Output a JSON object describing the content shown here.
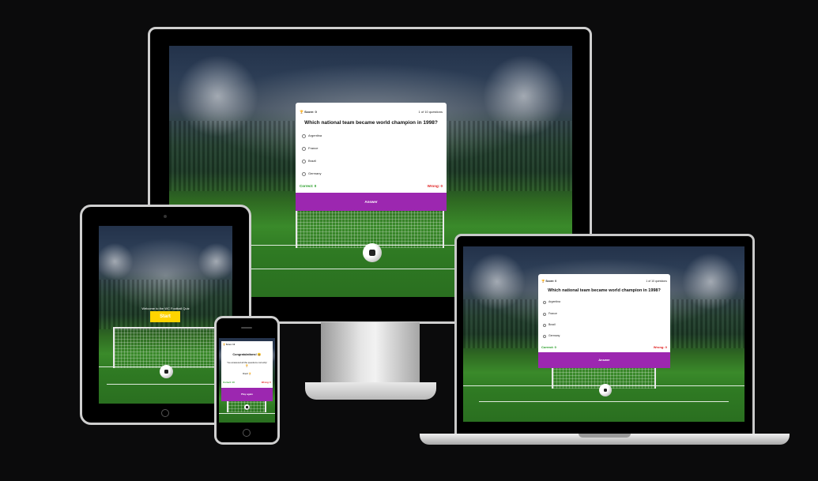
{
  "quiz": {
    "score_label": "Score: 0",
    "progress": "1 of 10 questions",
    "question": "Which national team became world champion in 1998?",
    "options": [
      "Argentina",
      "France",
      "Brazil",
      "Germany"
    ],
    "correct": "Correct: 0",
    "wrong": "Wrong: 0",
    "answer_button": "Answer"
  },
  "tablet": {
    "welcome": "Welcome to the WC Football Quiz",
    "start_button": "Start"
  },
  "phone": {
    "score_label": "Score: 10",
    "congrats": "Congratulations! 😄",
    "message": "You answered all the questions correctly!🏆",
    "score_line": "Brazil 🏆",
    "correct": "Correct: 10",
    "wrong": "Wrong: 0",
    "play_again": "Play again"
  },
  "colors": {
    "button_purple": "#9c27b0",
    "start_yellow": "#ffd400",
    "correct_green": "#1f9a1f",
    "wrong_red": "#e02020",
    "background": "#0b0b0c"
  }
}
